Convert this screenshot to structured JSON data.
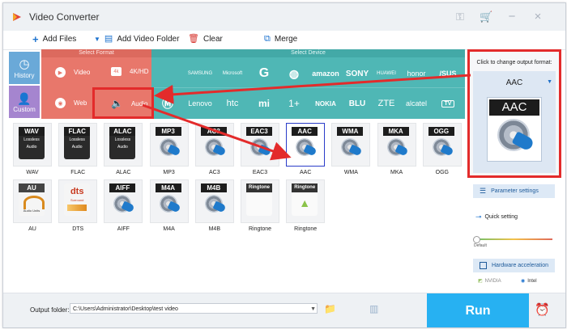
{
  "window": {
    "title": "Video Converter"
  },
  "toolbar": {
    "add_files": "Add Files",
    "add_video_folder": "Add Video Folder",
    "clear": "Clear",
    "merge": "Merge"
  },
  "categories": {
    "history": "History",
    "custom": "Custom",
    "select_format": "Select Format",
    "select_device": "Select Device",
    "format_types": [
      "Video",
      "4K/HD",
      "Web",
      "Audio"
    ]
  },
  "devices": {
    "row1": [
      "",
      "SAMSUNG",
      "Microsoft",
      "G",
      "",
      "amazon",
      "SONY",
      "HUAWEI",
      "honor",
      "/SUS"
    ],
    "row2": [
      "",
      "Lenovo",
      "htc",
      "mi",
      "1+",
      "NOKIA",
      "BLU",
      "ZTE",
      "alcatel",
      "TV"
    ]
  },
  "formats_row1": [
    {
      "tag": "WAV",
      "label": "WAV",
      "sub": "Lossless Audio",
      "kind": "lossless"
    },
    {
      "tag": "FLAC",
      "label": "FLAC",
      "sub": "Lossless Audio",
      "kind": "lossless"
    },
    {
      "tag": "ALAC",
      "label": "ALAC",
      "sub": "Lossless Audio",
      "kind": "lossless"
    },
    {
      "tag": "MP3",
      "label": "MP3",
      "kind": "disc"
    },
    {
      "tag": "AC3",
      "label": "AC3",
      "kind": "disc"
    },
    {
      "tag": "EAC3",
      "label": "EAC3",
      "kind": "disc"
    },
    {
      "tag": "AAC",
      "label": "AAC",
      "kind": "disc",
      "selected": true
    },
    {
      "tag": "WMA",
      "label": "WMA",
      "kind": "disc"
    },
    {
      "tag": "MKA",
      "label": "MKA",
      "kind": "disc"
    },
    {
      "tag": "OGG",
      "label": "OGG",
      "kind": "disc"
    }
  ],
  "formats_row2": [
    {
      "tag": "AU",
      "label": "AU",
      "sub": "Audio Units",
      "kind": "au"
    },
    {
      "tag": "dts",
      "label": "DTS",
      "sub": "Surround",
      "kind": "dts"
    },
    {
      "tag": "AIFF",
      "label": "AIFF",
      "kind": "disc"
    },
    {
      "tag": "M4A",
      "label": "M4A",
      "kind": "disc"
    },
    {
      "tag": "M4B",
      "label": "M4B",
      "kind": "disc"
    },
    {
      "tag": "Ringtone",
      "label": "Ringtone",
      "kind": "ring-apple"
    },
    {
      "tag": "Ringtone",
      "label": "Ringtone",
      "kind": "ring-android"
    }
  ],
  "right_panel": {
    "hint": "Click to change output format:",
    "current_format": "AAC",
    "icon_tag": "AAC",
    "parameter_settings": "Parameter settings",
    "quick_setting": "Quick setting",
    "quality_label": "Default",
    "hardware_acceleration": "Hardware acceleration",
    "gpu_nvidia": "NVIDIA",
    "gpu_intel": "Intel"
  },
  "bottom": {
    "output_folder_label": "Output folder:",
    "output_path": "C:\\Users\\Administrator\\Desktop\\test video",
    "run": "Run"
  },
  "colors": {
    "format_red": "#e8776b",
    "device_teal": "#4fb7b5",
    "history_blue": "#6aa9d8",
    "custom_purple": "#a585cf",
    "run_blue": "#27b1f2",
    "annotation_red": "#e32b2b"
  }
}
